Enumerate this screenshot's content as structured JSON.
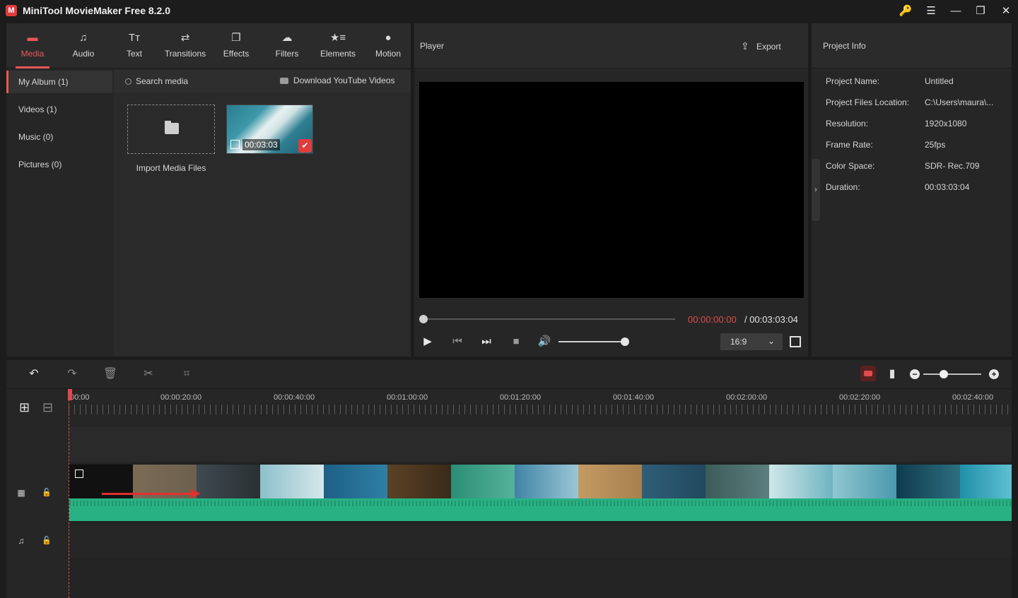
{
  "app": {
    "title": "MiniTool MovieMaker Free 8.2.0",
    "logo_glyph": "M"
  },
  "window_controls": {
    "key": "🔑",
    "menu": "☰",
    "minimize": "—",
    "restore": "❐",
    "close": "✕"
  },
  "tool_tabs": [
    {
      "label": "Media",
      "icon": "media-icon",
      "glyph": "▬",
      "active": true
    },
    {
      "label": "Audio",
      "icon": "music-note-icon",
      "glyph": "♫"
    },
    {
      "label": "Text",
      "icon": "text-icon",
      "glyph": "Tт"
    },
    {
      "label": "Transitions",
      "icon": "swap-arrows-icon",
      "glyph": "⇄"
    },
    {
      "label": "Effects",
      "icon": "effects-icon",
      "glyph": "❐"
    },
    {
      "label": "Filters",
      "icon": "filters-icon",
      "glyph": "☁"
    },
    {
      "label": "Elements",
      "icon": "elements-icon",
      "glyph": "★≡"
    },
    {
      "label": "Motion",
      "icon": "motion-icon",
      "glyph": "●"
    }
  ],
  "album": {
    "items": [
      {
        "label": "My Album (1)",
        "active": true
      },
      {
        "label": "Videos (1)"
      },
      {
        "label": "Music (0)"
      },
      {
        "label": "Pictures (0)"
      }
    ]
  },
  "media": {
    "search_label": "Search media",
    "youtube_label": "Download YouTube Videos",
    "import_label": "Import Media Files",
    "clip_duration": "00:03:03",
    "check_glyph": "✔"
  },
  "player": {
    "title": "Player",
    "export_label": "Export",
    "export_glyph": "⇪",
    "time_current": "00:00:00:00",
    "time_total": " / 00:03:03:04",
    "aspect_ratio": "16:9",
    "chevron": "⌄",
    "controls": {
      "play": "▶",
      "prev": "⏮",
      "next": "⏭",
      "stop": "■",
      "volume": "🔊"
    },
    "progress_fraction": 0.0,
    "volume_fraction": 0.94
  },
  "project_info": {
    "title": "Project Info",
    "rows": [
      {
        "key": "Project Name:",
        "value": "Untitled"
      },
      {
        "key": "Project Files Location:",
        "value": "C:\\Users\\maura\\..."
      },
      {
        "key": "Resolution:",
        "value": "1920x1080"
      },
      {
        "key": "Frame Rate:",
        "value": "25fps"
      },
      {
        "key": "Color Space:",
        "value": "SDR- Rec.709"
      },
      {
        "key": "Duration:",
        "value": "00:03:03:04"
      }
    ],
    "collapse_glyph": "›"
  },
  "timeline": {
    "toolbar": {
      "undo": "↶",
      "redo": "↷",
      "delete": "🗑",
      "cut": "✂",
      "crop": "⌗",
      "snap": "▮",
      "zoom_out": "−",
      "zoom_in": "+"
    },
    "zoom_fraction": 0.35,
    "ruler_labels": [
      "00:00",
      "00:00:20:00",
      "00:00:40:00",
      "00:01:00:00",
      "00:01:20:00",
      "00:01:40:00",
      "00:02:00:00",
      "00:02:20:00",
      "00:02:40:00"
    ],
    "header_glyphs": {
      "add_track": "⊞",
      "remove_track": "⊟",
      "video_track": "▦",
      "audio_track": "♫",
      "lock": "🔓"
    }
  },
  "colors": {
    "accent": "#e85757",
    "waveform": "#28b183",
    "playhead": "#e04b4b"
  }
}
